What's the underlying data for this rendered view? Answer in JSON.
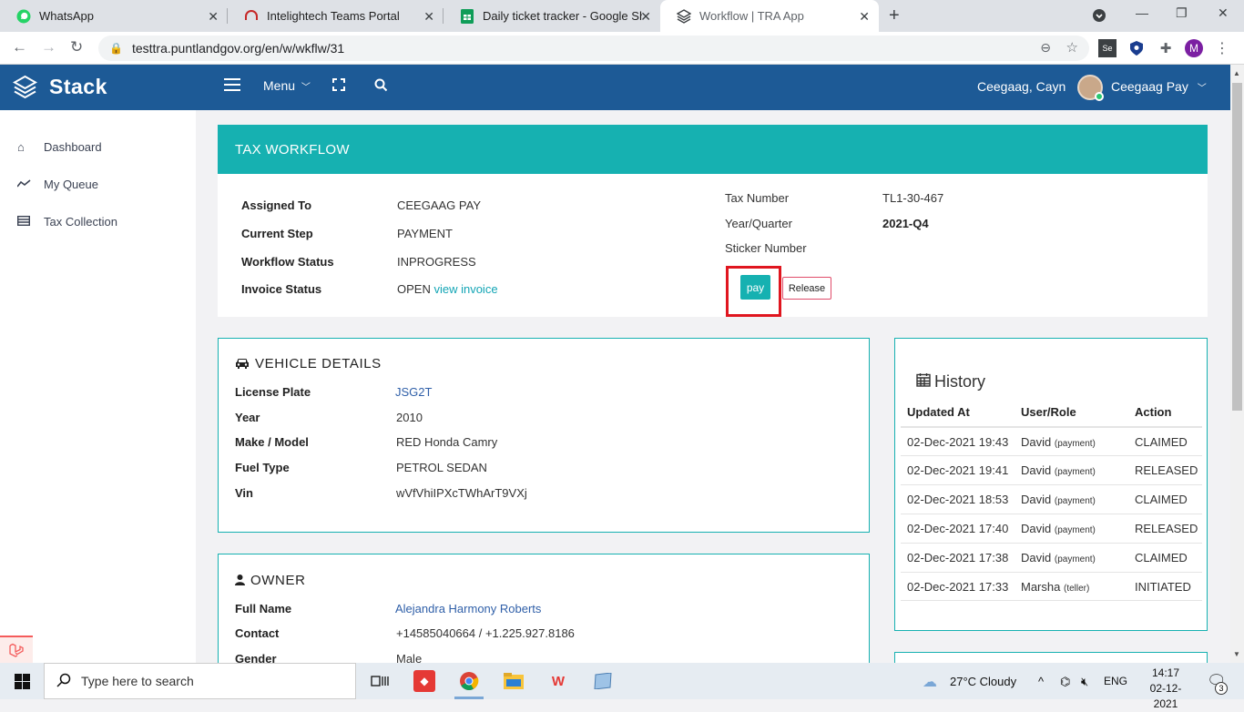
{
  "browser": {
    "tabs": [
      {
        "title": "WhatsApp",
        "icon": "whatsapp-icon"
      },
      {
        "title": "Intelightech Teams Portal",
        "icon": "headset-icon"
      },
      {
        "title": "Daily ticket tracker - Google Shee",
        "icon": "sheets-icon"
      },
      {
        "title": "Workflow | TRA App",
        "icon": "stack-icon",
        "active": true
      }
    ],
    "url": "testtra.puntlandgov.org/en/w/wkflw/31",
    "profile_initial": "M"
  },
  "header": {
    "brand": "Stack",
    "menu_label": "Menu",
    "user_primary": "Ceegaag, Cayn",
    "user_secondary": "Ceegaag Pay"
  },
  "sidebar": {
    "items": [
      {
        "label": "Dashboard",
        "icon": "home-icon"
      },
      {
        "label": "My Queue",
        "icon": "activity-icon"
      },
      {
        "label": "Tax Collection",
        "icon": "list-icon"
      }
    ]
  },
  "workflow": {
    "title": "TAX WORKFLOW",
    "assigned_to_label": "Assigned To",
    "assigned_to": "CEEGAAG PAY",
    "current_step_label": "Current Step",
    "current_step": "PAYMENT",
    "workflow_status_label": "Workflow Status",
    "workflow_status": "INPROGRESS",
    "invoice_status_label": "Invoice Status",
    "invoice_status": "OPEN",
    "view_invoice": "view invoice",
    "tax_number_label": "Tax Number",
    "tax_number": "TL1-30-467",
    "year_quarter_label": "Year/Quarter",
    "year_quarter": "2021-Q4",
    "sticker_number_label": "Sticker Number",
    "pay_label": "pay",
    "release_label": "Release"
  },
  "vehicle": {
    "title": "VEHICLE DETAILS",
    "rows": [
      {
        "label": "License Plate",
        "value": "JSG2T"
      },
      {
        "label": "Year",
        "value": "2010"
      },
      {
        "label": "Make / Model",
        "value": "RED Honda Camry"
      },
      {
        "label": "Fuel Type",
        "value": "PETROL SEDAN"
      },
      {
        "label": "Vin",
        "value": "wVfVhiIPXcTWhArT9VXj"
      }
    ]
  },
  "owner": {
    "title": "OWNER",
    "rows": [
      {
        "label": "Full Name",
        "value": "Alejandra Harmony Roberts"
      },
      {
        "label": "Contact",
        "value": "+14585040664 / +1.225.927.8186"
      },
      {
        "label": "Gender",
        "value": "Male"
      }
    ]
  },
  "history": {
    "title": "History",
    "headers": [
      "Updated At",
      "User/Role",
      "Action"
    ],
    "rows": [
      {
        "date": "02-Dec-2021 19:43",
        "user": "David",
        "role": "(payment)",
        "action": "CLAIMED"
      },
      {
        "date": "02-Dec-2021 19:41",
        "user": "David",
        "role": "(payment)",
        "action": "RELEASED"
      },
      {
        "date": "02-Dec-2021 18:53",
        "user": "David",
        "role": "(payment)",
        "action": "CLAIMED"
      },
      {
        "date": "02-Dec-2021 17:40",
        "user": "David",
        "role": "(payment)",
        "action": "RELEASED"
      },
      {
        "date": "02-Dec-2021 17:38",
        "user": "David",
        "role": "(payment)",
        "action": "CLAIMED"
      },
      {
        "date": "02-Dec-2021 17:33",
        "user": "Marsha",
        "role": "(teller)",
        "action": "INITIATED"
      }
    ]
  },
  "taskbar": {
    "search_placeholder": "Type here to search",
    "weather": "27°C  Cloudy",
    "language": "ENG",
    "time": "14:17",
    "date": "02-12-2021",
    "notifications": "3"
  }
}
